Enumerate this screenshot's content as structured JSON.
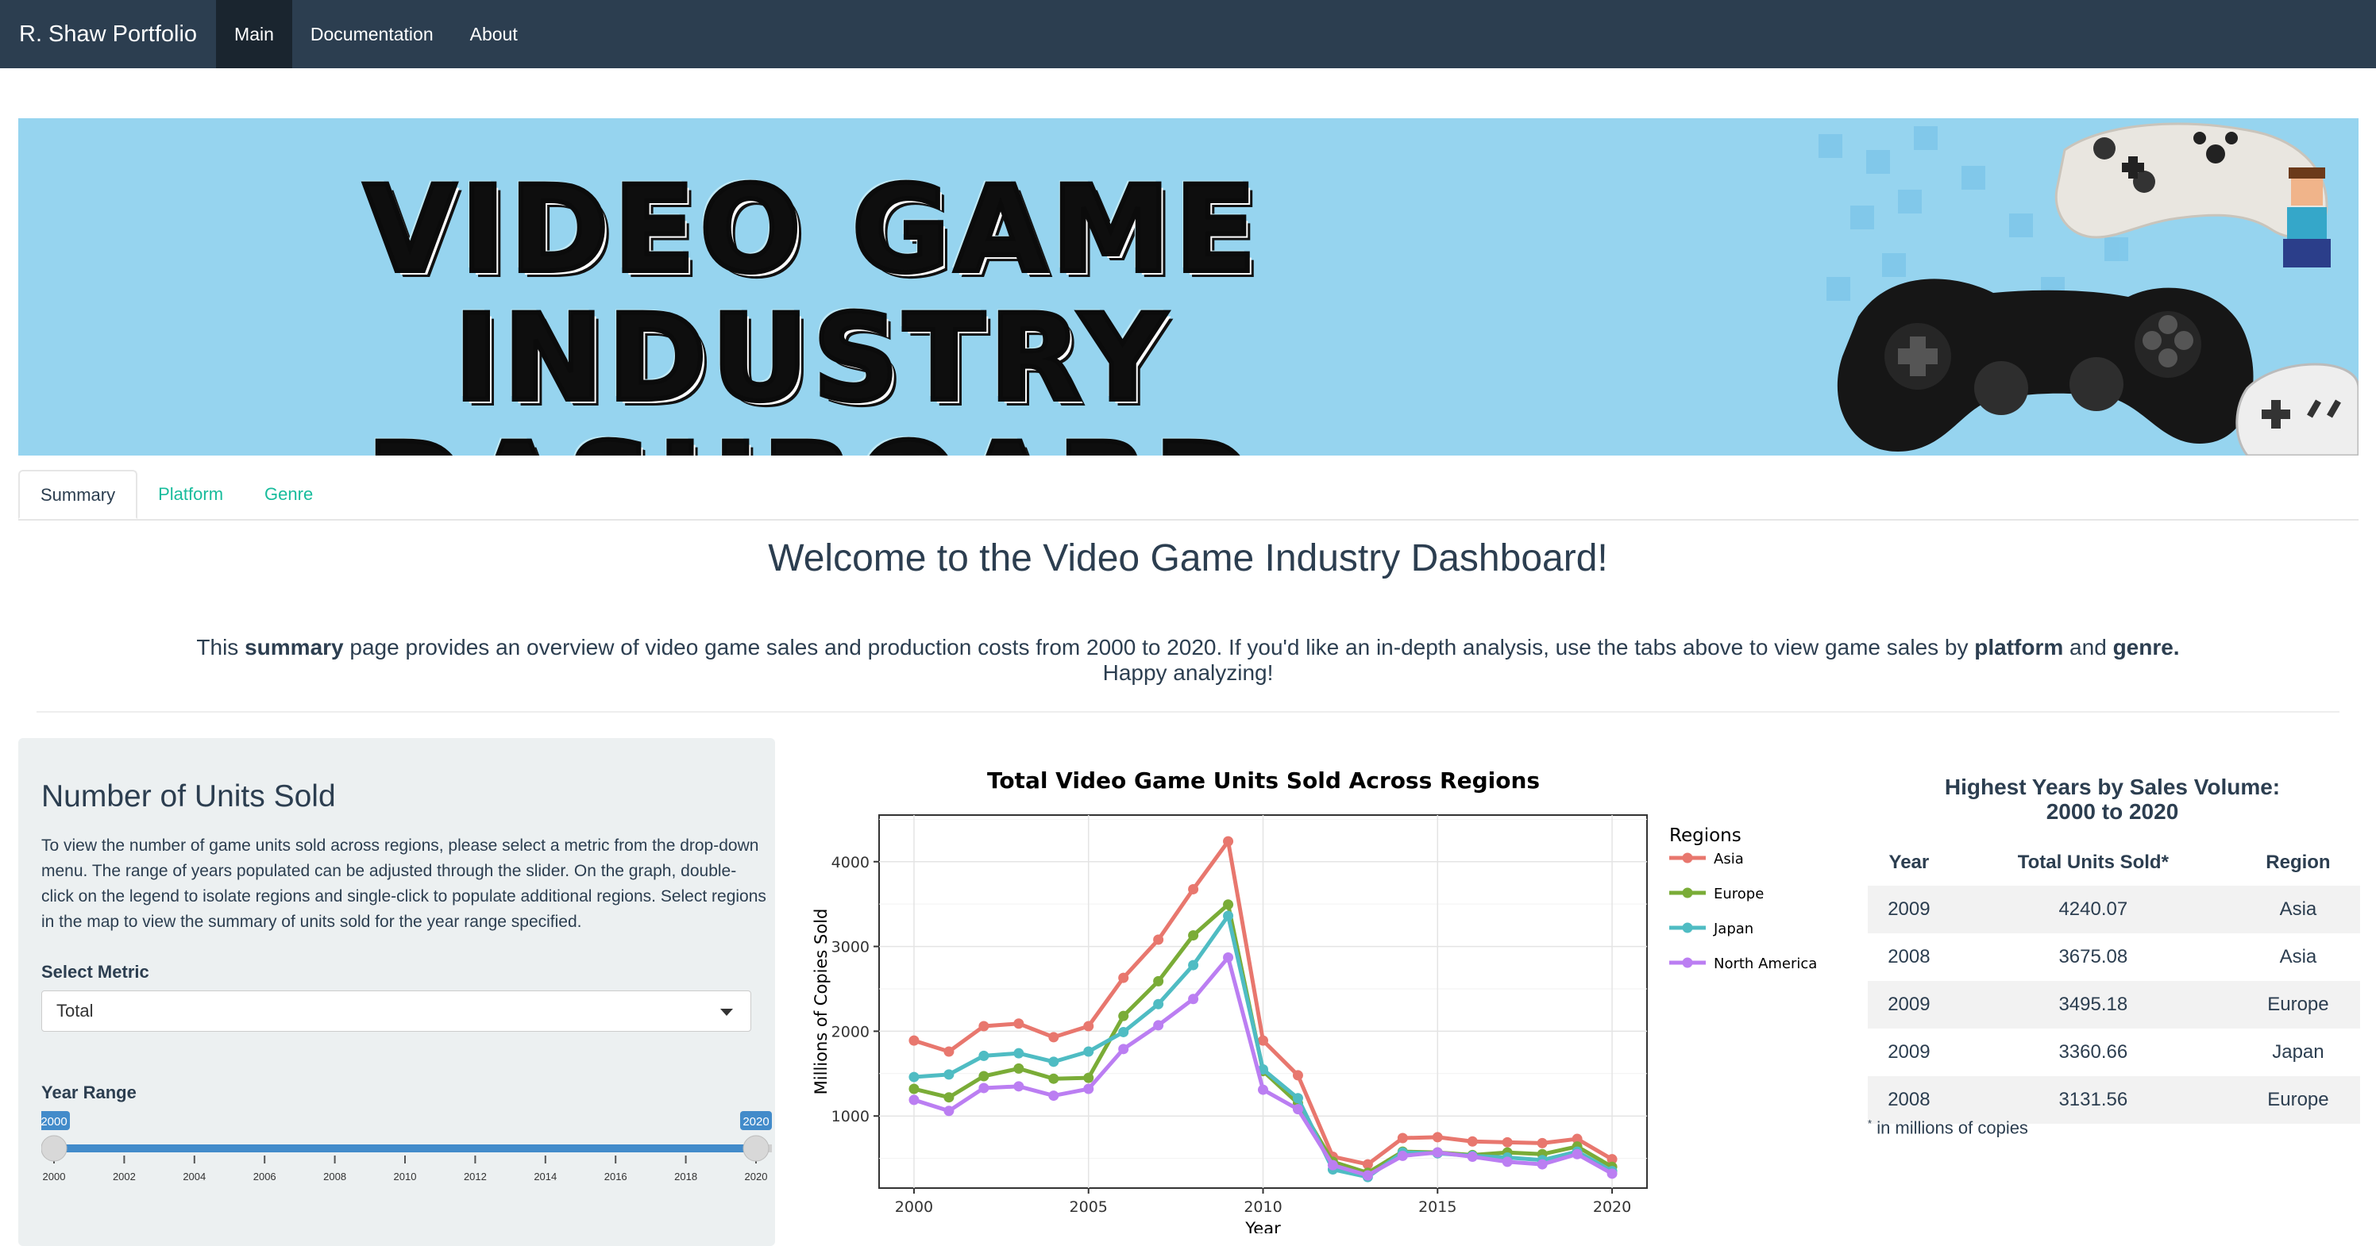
{
  "nav": {
    "brand": "R. Shaw Portfolio",
    "items": [
      "Main",
      "Documentation",
      "About"
    ],
    "active": "Main"
  },
  "banner": {
    "title_line1": "VIDEO GAME INDUSTRY",
    "title_line2": "DASHBOARD"
  },
  "tabs": {
    "items": [
      "Summary",
      "Platform",
      "Genre"
    ],
    "active": "Summary"
  },
  "welcome": "Welcome to the Video Game Industry Dashboard!",
  "intro": {
    "p1": "This ",
    "b1": "summary",
    "p2": " page provides an overview of video game sales and production costs from 2000 to 2020. If you'd like an in-depth analysis, use the tabs above to view game sales by ",
    "b2": "platform",
    "p3": " and ",
    "b3": "genre.",
    "p4": "Happy analyzing!"
  },
  "panel": {
    "title": "Number of Units Sold",
    "description": "To view the number of game units sold across regions, please select a metric from the drop-down menu. The range of years populated can be adjusted through the slider. On the graph, double-click on the legend to isolate regions and single-click to populate additional regions. Select regions in the map to view the summary of units sold for the year range specified.",
    "metric_label": "Select Metric",
    "metric_value": "Total",
    "range_label": "Year Range",
    "range_from": "2000",
    "range_to": "2020",
    "ticks": [
      "2000",
      "2002",
      "2004",
      "2006",
      "2008",
      "2010",
      "2012",
      "2014",
      "2016",
      "2018",
      "2020"
    ]
  },
  "colors": {
    "nav": "#2c3e50",
    "accent": "#18bc9c",
    "slider": "#428bca",
    "Asia": "#e8776e",
    "Europe": "#7aac37",
    "Japan": "#4fbcc3",
    "North America": "#bb7ef2"
  },
  "chart_data": {
    "type": "line",
    "title": "Total Video Game Units Sold Across Regions",
    "xlabel": "Year",
    "ylabel": "Millions of Copies Sold",
    "legend_title": "Regions",
    "legend_position": "right",
    "x": [
      2000,
      2001,
      2002,
      2003,
      2004,
      2005,
      2006,
      2007,
      2008,
      2009,
      2010,
      2011,
      2012,
      2013,
      2014,
      2015,
      2016,
      2017,
      2018,
      2019,
      2020
    ],
    "xticks": [
      2000,
      2005,
      2010,
      2015,
      2020
    ],
    "yticks": [
      1000,
      2000,
      3000,
      4000
    ],
    "xlim": [
      1999.0,
      2021.0
    ],
    "ylim": [
      150,
      4550
    ],
    "grid": true,
    "series": [
      {
        "name": "Asia",
        "values": [
          1890,
          1760,
          2060,
          2090,
          1930,
          2060,
          2630,
          3080,
          3675,
          4240,
          1890,
          1480,
          520,
          430,
          740,
          750,
          700,
          690,
          680,
          730,
          490
        ]
      },
      {
        "name": "Europe",
        "values": [
          1320,
          1220,
          1470,
          1560,
          1440,
          1450,
          2180,
          2590,
          3131,
          3495,
          1530,
          1150,
          460,
          330,
          580,
          570,
          540,
          570,
          550,
          640,
          400
        ]
      },
      {
        "name": "Japan",
        "values": [
          1460,
          1490,
          1710,
          1740,
          1640,
          1760,
          1990,
          2320,
          2780,
          3361,
          1550,
          1210,
          370,
          280,
          570,
          560,
          530,
          510,
          480,
          580,
          350
        ]
      },
      {
        "name": "North America",
        "values": [
          1190,
          1060,
          1330,
          1350,
          1240,
          1320,
          1790,
          2070,
          2380,
          2870,
          1310,
          1080,
          420,
          300,
          530,
          570,
          520,
          460,
          430,
          550,
          320
        ]
      }
    ]
  },
  "highest": {
    "title_line1": "Highest Years by Sales Volume:",
    "title_line2": "2000 to 2020",
    "headers": [
      "Year",
      "Total Units Sold*",
      "Region"
    ],
    "rows": [
      [
        "2009",
        "4240.07",
        "Asia"
      ],
      [
        "2008",
        "3675.08",
        "Asia"
      ],
      [
        "2009",
        "3495.18",
        "Europe"
      ],
      [
        "2009",
        "3360.66",
        "Japan"
      ],
      [
        "2008",
        "3131.56",
        "Europe"
      ]
    ],
    "footnote_mark": "*",
    "footnote": "in millions of copies"
  }
}
